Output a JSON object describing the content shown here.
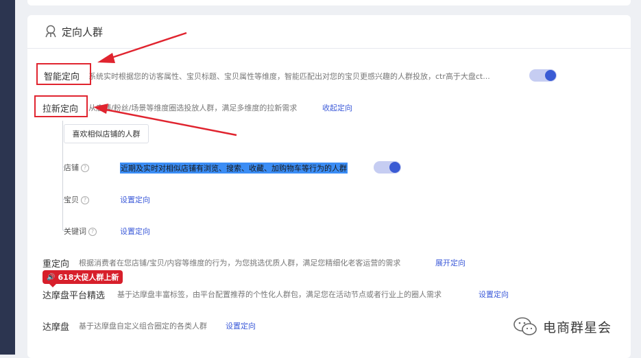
{
  "card": {
    "title": "定向人群"
  },
  "smart": {
    "label": "智能定向",
    "desc": "系统实时根据您的访客属性、宝贝标题、宝贝属性等维度，智能匹配出对您的宝贝更感兴趣的人群投放，ctr高于大盘ct...",
    "enabled": true
  },
  "new_customer": {
    "label": "拉新定向",
    "desc": "从店铺/粉丝/场景等维度圈选投放人群，满足多维度的拉新需求",
    "link": "收起定向",
    "sub_button": "喜欢相似店铺的人群",
    "items": [
      {
        "label": "店铺",
        "help": "?",
        "value": "近期及实时对相似店铺有浏览、搜索、收藏、加购物车等行为的人群",
        "enabled": true
      },
      {
        "label": "宝贝",
        "help": "?",
        "link": "设置定向"
      },
      {
        "label": "关键词",
        "help": "?",
        "link": "设置定向"
      }
    ]
  },
  "retarget": {
    "label": "重定向",
    "desc": "根据消费者在您店铺/宝贝/内容等维度的行为，为您挑选优质人群，满足您精细化老客运营的需求",
    "link": "展开定向"
  },
  "promo_badge": "618大促人群上新",
  "damopan_select": {
    "label": "达摩盘平台精选",
    "desc": "基于达摩盘丰富标签，由平台配置推荐的个性化人群包，满足您在活动节点或者行业上的圈人需求",
    "link": "设置定向"
  },
  "damopan": {
    "label": "达摩盘",
    "desc": "基于达摩盘自定义组合圈定的各类人群",
    "link": "设置定向"
  },
  "watermark": "电商群星会",
  "colors": {
    "accent": "#3a5bd4",
    "annotation_red": "#e0242f",
    "badge_red": "#d71f2b",
    "highlight": "#3b8df5"
  }
}
